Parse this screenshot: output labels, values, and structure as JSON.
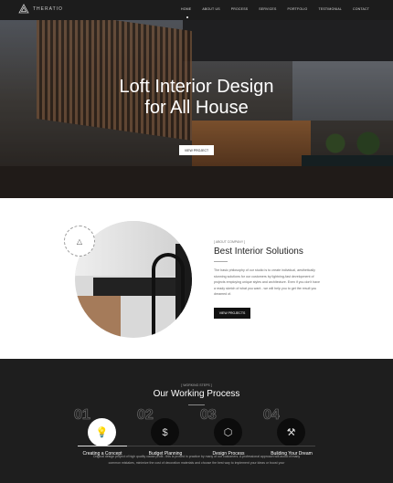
{
  "nav": {
    "logo": "THERATIO",
    "items": [
      "HOME",
      "ABOUT US",
      "PROCESS",
      "SERVICES",
      "PORTFOLIO",
      "TESTIMONIAL",
      "CONTACT"
    ],
    "active": "HOME"
  },
  "hero": {
    "title_line1": "Loft Interior Design",
    "title_line2": "for All House",
    "button": "VIEW PROJECT"
  },
  "about": {
    "badge": "we are theratio",
    "subtitle": "[ ABOUT COMPANY ]",
    "title": "Best Interior Solutions",
    "text": "The basic philosophy of our studio is to create individual, aesthetically stunning solutions for our customers by lightning-fast development of projects employing unique styles and architecture. Even if you don't have a ready sketch of what you want - we will help you to get the result you dreamed of.",
    "button": "VIEW PROJECTS"
  },
  "process": {
    "subtitle": "[ WORKING STEPS ]",
    "title": "Our Working Process",
    "steps": [
      {
        "num": "01",
        "label": "Creating a Concept",
        "icon": "lightbulb-icon"
      },
      {
        "num": "02",
        "label": "Budget Planning",
        "icon": "money-hand-icon"
      },
      {
        "num": "03",
        "label": "Design Process",
        "icon": "cube-icon"
      },
      {
        "num": "04",
        "label": "Building Your Dream",
        "icon": "tools-icon"
      }
    ],
    "text": "Original design project of high quality cause profit - this is proved in practice by many of our customers. A professional approach will avoid of many common mistakes, minimize the cost of decoration materials and choose the best way to implement your ideas or boost your"
  }
}
